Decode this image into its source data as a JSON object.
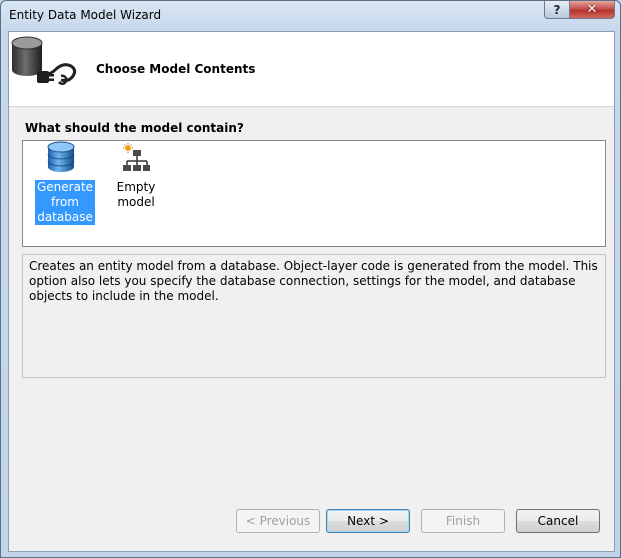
{
  "window": {
    "title": "Entity Data Model Wizard",
    "help_label": "?",
    "close_label": "✕"
  },
  "header": {
    "title": "Choose Model Contents",
    "icon": "database-plug-icon"
  },
  "question": "What should the model contain?",
  "choices": [
    {
      "label_lines": [
        "Generate",
        "from",
        "database"
      ],
      "icon": "database-icon",
      "selected": true
    },
    {
      "label": "Empty model",
      "icon": "hierarchy-icon",
      "selected": false
    }
  ],
  "description": "Creates an entity model from a database. Object-layer code is generated from the model. This option also lets you specify the database connection, settings for the model, and database objects to include in the model.",
  "buttons": {
    "previous": "< Previous",
    "next": "Next >",
    "finish": "Finish",
    "cancel": "Cancel"
  },
  "colors": {
    "selection": "#3399ff",
    "close_button": "#c75050",
    "frame": "#c4d6ea"
  }
}
